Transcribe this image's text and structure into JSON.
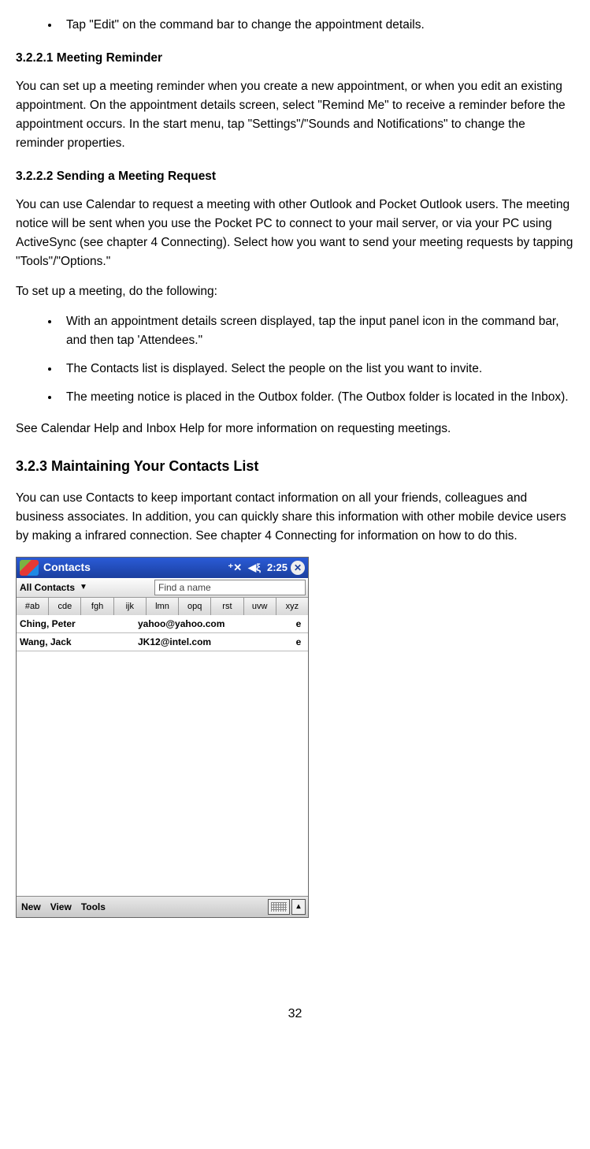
{
  "bullets_top": [
    "Tap \"Edit\" on the command bar to change the appointment details."
  ],
  "h_3_2_2_1": "3.2.2.1 Meeting Reminder",
  "p_reminder": "You can set up a meeting reminder when you create a new appointment, or when you edit an existing appointment. On the appointment details screen, select \"Remind Me\" to receive a reminder before the appointment occurs. In the start menu, tap \"Settings\"/\"Sounds and Notifications\" to change the reminder properties.",
  "h_3_2_2_2": "3.2.2.2 Sending a Meeting Request",
  "p_request": "You can use Calendar to request a meeting with other Outlook and Pocket Outlook users. The meeting notice will be sent when you use the Pocket PC to connect to your mail server, or via your PC using ActiveSync (see chapter 4 Connecting). Select how you want to send your meeting requests by tapping \"Tools\"/\"Options.\"",
  "p_setup": "To set up a meeting, do the following:",
  "bullets_mid": [
    "With an appointment details screen displayed, tap the input panel icon in the command bar, and then tap 'Attendees.\"",
    "The Contacts list is displayed. Select the people on the list you want to invite.",
    "The meeting notice is placed in the Outbox folder. (The Outbox folder is located in the Inbox)."
  ],
  "p_seehelp": "See Calendar Help and Inbox Help for more information on requesting meetings.",
  "h_3_2_3": "3.2.3 Maintaining Your Contacts List",
  "p_contacts": "You can use Contacts to keep important contact information on all your friends, colleagues and business associates. In addition, you can quickly share this information with other mobile device users by making a infrared connection. See chapter 4 Connecting for information on how to do this.",
  "screenshot": {
    "app_title": "Contacts",
    "time": "2:25",
    "conn_glyph": "⁺✕",
    "vol_glyph": "◀ξ",
    "close_glyph": "✕",
    "category": "All Contacts",
    "find_placeholder": "Find a name",
    "index_tabs": [
      "#ab",
      "cde",
      "fgh",
      "ijk",
      "lmn",
      "opq",
      "rst",
      "uvw",
      "xyz"
    ],
    "rows": [
      {
        "name": "Ching, Peter",
        "mail": "yahoo@yahoo.com",
        "tag": "e"
      },
      {
        "name": "Wang, Jack",
        "mail": "JK12@intel.com",
        "tag": "e"
      }
    ],
    "menu": {
      "new": "New",
      "view": "View",
      "tools": "Tools"
    },
    "up_glyph": "▴"
  },
  "page_number": "32"
}
